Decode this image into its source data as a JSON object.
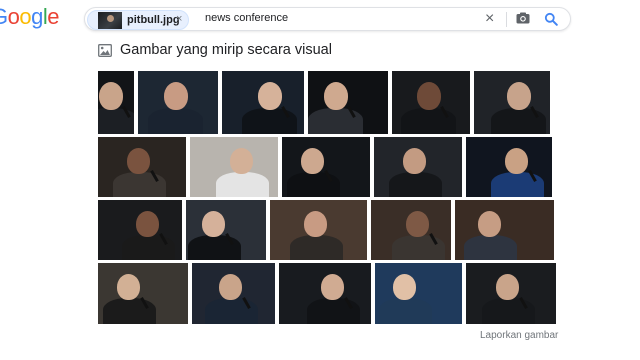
{
  "header": {
    "logo_letters": [
      {
        "ch": "o",
        "color": "#ea4335"
      },
      {
        "ch": "o",
        "color": "#fbbc05"
      },
      {
        "ch": "g",
        "color": "#4285f4"
      },
      {
        "ch": "l",
        "color": "#34a853"
      },
      {
        "ch": "e",
        "color": "#ea4335"
      }
    ],
    "logo_leading": {
      "ch": "G",
      "color": "#4285f4"
    }
  },
  "search": {
    "chip_label": "pitbull.jpg",
    "chip_close": "×",
    "query": "news conference",
    "clear_icon": "×"
  },
  "section": {
    "title": "Gambar yang mirip secara visual"
  },
  "footer": {
    "report_link": "Laporkan gambar"
  },
  "colors": {
    "accent": "#1a73e8",
    "chip_bg": "#e8f0fe"
  },
  "gallery": {
    "rows": [
      [
        {
          "bg": "#121417",
          "skin": "#c9a48a",
          "shirt": "#1c1f24",
          "mic": true
        },
        {
          "bg": "#1d2733",
          "skin": "#c89b83",
          "shirt": "#1a2330",
          "mic": false
        },
        {
          "bg": "#18202b",
          "skin": "#d6b29a",
          "shirt": "#0f1318",
          "mic": true
        },
        {
          "bg": "#0f1114",
          "skin": "#cfa98f",
          "shirt": "#2a2d33",
          "mic": true
        },
        {
          "bg": "#181a1d",
          "skin": "#6e4a38",
          "shirt": "#121417",
          "mic": true
        },
        {
          "bg": "#202328",
          "skin": "#c7a38b",
          "shirt": "#141619",
          "mic": true
        }
      ],
      [
        {
          "bg": "#2a2521",
          "skin": "#7a533f",
          "shirt": "#3b3632",
          "mic": true
        },
        {
          "bg": "#b8b4ae",
          "skin": "#d3b097",
          "shirt": "#e4e4e4",
          "mic": false
        },
        {
          "bg": "#13161a",
          "skin": "#cda88f",
          "shirt": "#0e1013",
          "mic": true
        },
        {
          "bg": "#22252a",
          "skin": "#c39b82",
          "shirt": "#15171a",
          "mic": false
        },
        {
          "bg": "#10151f",
          "skin": "#c9a184",
          "shirt": "#1b3b75",
          "mic": true
        }
      ],
      [
        {
          "bg": "#1a1b1d",
          "skin": "#7a533f",
          "shirt": "#1a1a1a",
          "mic": true
        },
        {
          "bg": "#2b3038",
          "skin": "#d5b19a",
          "shirt": "#101215",
          "mic": true
        },
        {
          "bg": "#4a3a30",
          "skin": "#c89b83",
          "shirt": "#2e2a27",
          "mic": false
        },
        {
          "bg": "#3a2e27",
          "skin": "#7e5945",
          "shirt": "#3a3531",
          "mic": true
        },
        {
          "bg": "#3a2c24",
          "skin": "#c69d84",
          "shirt": "#2e3440",
          "mic": false
        }
      ],
      [
        {
          "bg": "#3b3732",
          "skin": "#d2b095",
          "shirt": "#1b1b1b",
          "mic": true
        },
        {
          "bg": "#202632",
          "skin": "#c9a48a",
          "shirt": "#1a2534",
          "mic": true
        },
        {
          "bg": "#181b1f",
          "skin": "#d0ab92",
          "shirt": "#111316",
          "mic": true
        },
        {
          "bg": "#1f3a5c",
          "skin": "#e1c0a6",
          "shirt": "#203a58",
          "mic": false
        },
        {
          "bg": "#1a1c1f",
          "skin": "#c9a48a",
          "shirt": "#16181b",
          "mic": true
        }
      ]
    ]
  }
}
